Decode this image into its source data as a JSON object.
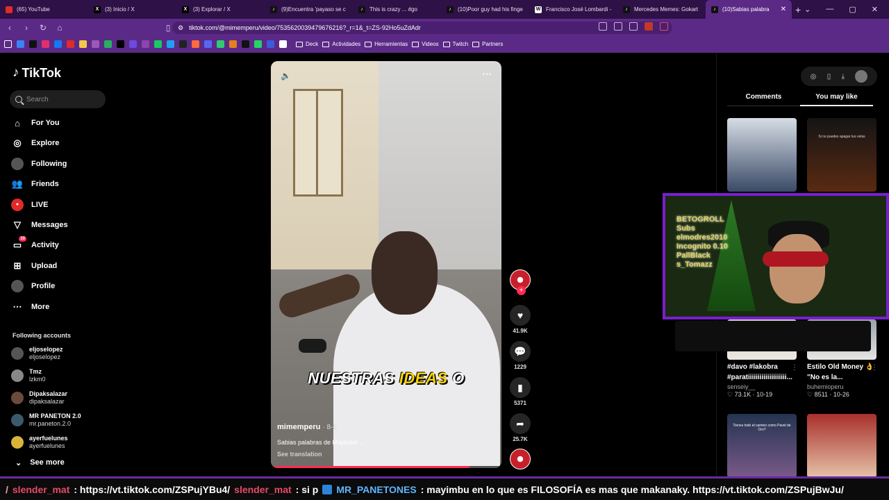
{
  "browser": {
    "tabs": [
      {
        "title": "(65) YouTube",
        "icon_color": "#e02b2b",
        "icon": "youtube-icon"
      },
      {
        "title": "(3) Inicio / X",
        "icon_color": "#000000",
        "icon": "x-icon"
      },
      {
        "title": "(3) Explorar / X",
        "icon_color": "#000000",
        "icon": "x-icon"
      },
      {
        "title": "(9)Encuentra 'payaso se c",
        "icon_color": "#111111",
        "icon": "tiktok-icon"
      },
      {
        "title": "This is crazy ... #go",
        "icon_color": "#111111",
        "icon": "tiktok-icon"
      },
      {
        "title": "(10)Poor guy had his finge",
        "icon_color": "#111111",
        "icon": "tiktok-icon"
      },
      {
        "title": "Francisco José Lombardi -",
        "icon_color": "#ffffff",
        "icon": "wikipedia-icon"
      },
      {
        "title": "Mercedes Memes: Gokart",
        "icon_color": "#111111",
        "icon": "tiktok-icon"
      },
      {
        "title": "(10)Sabias palabra",
        "icon_color": "#111111",
        "icon": "tiktok-icon",
        "active": true
      }
    ],
    "url": "tiktok.com/@mimemperu/video/7535620039479676216?_r=1&_t=ZS-92Ho5uZdAdr",
    "bookmarks": [
      "Deck",
      "Actividades",
      "Herramientas",
      "Videos",
      "Twitch",
      "Partners"
    ]
  },
  "sidebar": {
    "logo": "TikTok",
    "search_placeholder": "Search",
    "nav": [
      {
        "label": "For You",
        "icon": "home-icon",
        "glyph": "⌂"
      },
      {
        "label": "Explore",
        "icon": "compass-icon",
        "glyph": "◎"
      },
      {
        "label": "Following",
        "icon": "following-avatar-icon",
        "glyph": "◍"
      },
      {
        "label": "Friends",
        "icon": "friends-icon",
        "glyph": "👥"
      },
      {
        "label": "LIVE",
        "icon": "live-icon",
        "glyph": "●"
      },
      {
        "label": "Messages",
        "icon": "messages-icon",
        "glyph": "▽"
      },
      {
        "label": "Activity",
        "icon": "activity-icon",
        "glyph": "▭",
        "badge": "10"
      },
      {
        "label": "Upload",
        "icon": "upload-icon",
        "glyph": "⊞"
      },
      {
        "label": "Profile",
        "icon": "profile-avatar-icon",
        "glyph": "●"
      },
      {
        "label": "More",
        "icon": "more-icon",
        "glyph": "⋯"
      }
    ],
    "following_title": "Following accounts",
    "accounts": [
      {
        "name": "eljoselopez",
        "handle": "eljoselopez",
        "color": "#555555"
      },
      {
        "name": "Tmz",
        "handle": "lzkm0",
        "color": "#888888"
      },
      {
        "name": "Dipaksalazar",
        "handle": "dipaksalazar",
        "color": "#6b4a3a"
      },
      {
        "name": "MR PANETON 2.0",
        "handle": "mr.paneton.2.0",
        "color": "#3a5a6b"
      },
      {
        "name": "ayerfuelunes",
        "handle": "ayerfuelunes",
        "color": "#d8b43a"
      }
    ],
    "see_more": "See more"
  },
  "video": {
    "caption_parts": [
      "NUESTRAS ",
      "IDEAS",
      " O"
    ],
    "author": "mimemperu",
    "date": "· 8-6",
    "description": "Sabias palabras de Mayimbó ...",
    "see_translation": "See translation",
    "progress": 0.86
  },
  "actions": {
    "likes": "41.9K",
    "comments": "1229",
    "saves": "5371",
    "shares": "25.7K"
  },
  "right_panel": {
    "tabs": [
      "Comments",
      "You may like"
    ],
    "active_tab": "You may like",
    "thumb_overlay_texts": [
      "Si no puedes apagar tus velas",
      "Tienes todo el camino como Pavel de Oro?"
    ],
    "cards": [
      {
        "title": "#davo #lakobra #paratiiiiiiiiiiiiiiiiiiii...",
        "author": "senseiy__",
        "stats": "♡ 73.1K · 10-19"
      },
      {
        "title": "Estilo Old Money 👌 \"No es la...",
        "author": "buhemioperu",
        "stats": "♡ 8511 · 10-26"
      }
    ]
  },
  "stream_overlay": {
    "neon_lines": [
      "BETOGROLL",
      "Subs",
      "elmodres2010",
      "Incognito 0.10",
      "PallBlack",
      "s_Tomazz"
    ]
  },
  "chat_ticker": {
    "segments": [
      {
        "user": "/",
        "text": ""
      },
      {
        "user": "slender_mat",
        "text": ": https://vt.tiktok.com/ZSPujYBu4/"
      },
      {
        "user": "slender_mat",
        "text": ": si p"
      },
      {
        "user": "MR_PANETONES",
        "text": ": mayimbu en lo que es FILOSOFÍA es mas que makanaky. https://vt.tiktok.com/ZSPujBwJu/"
      }
    ]
  }
}
